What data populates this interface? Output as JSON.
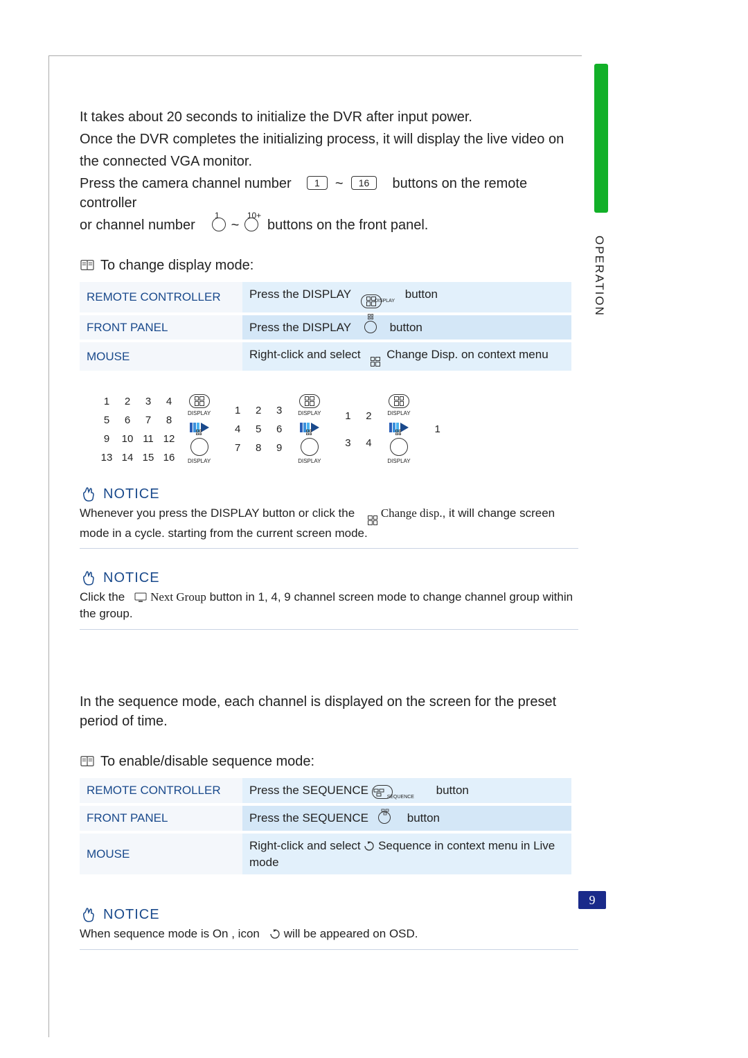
{
  "sideTab": "OPERATION",
  "pageNumber": "9",
  "intro": {
    "line1": "It takes about 20 seconds to initialize the DVR after input power.",
    "line2a": "Once the DVR completes the initializing process, it will display the live video on",
    "line2b": "the connected VGA monitor.",
    "line3a": "Press the camera channel number",
    "chanFrom": "1",
    "chanTilde": "~",
    "chanTo": "16",
    "line3b": "buttons on the remote controller",
    "line4a": "or channel number",
    "fp1": "1",
    "fpTilde": "~",
    "fp10": "10+",
    "line4b": "buttons on the front panel."
  },
  "changeDisplay": {
    "heading": "To change display mode:",
    "rows": [
      {
        "left": "REMOTE CONTROLLER",
        "rightA": "Press the DISPLAY",
        "rightB": "button"
      },
      {
        "left": "FRONT PANEL",
        "rightA": "Press the DISPLAY",
        "rightB": "button"
      },
      {
        "left": "MOUSE",
        "rightA": "Right-click and select",
        "rightB": "Change Disp. on context menu"
      }
    ],
    "iconSub": "DISPLAY"
  },
  "modes": {
    "grid16": [
      "1",
      "2",
      "3",
      "4",
      "5",
      "6",
      "7",
      "8",
      "9",
      "10",
      "11",
      "12",
      "13",
      "14",
      "15",
      "16"
    ],
    "grid9": [
      "1",
      "2",
      "3",
      "4",
      "5",
      "6",
      "7",
      "8",
      "9"
    ],
    "grid4": [
      "1",
      "2",
      "3",
      "4"
    ],
    "grid1": [
      "1"
    ],
    "sub": "DISPLAY"
  },
  "notice1": {
    "title": "NOTICE",
    "a": "Whenever you press the  DISPLAY button or click the",
    "ital": "Change disp.",
    "b": ", it will change screen",
    "c": "mode in a cycle. starting from the current screen mode."
  },
  "notice2": {
    "title": "NOTICE",
    "a": "Click the",
    "ital": "Next Group",
    "b": "button in 1, 4, 9 channel screen mode to change channel group within",
    "c": "the group."
  },
  "sequence": {
    "intro1": "In the sequence mode, each channel is displayed on the screen for the preset",
    "intro2": "period of time.",
    "heading": "To enable/disable sequence mode:",
    "rows": [
      {
        "left": "REMOTE CONTROLLER",
        "rightA": "Press the SEQUENCE",
        "rightB": "button"
      },
      {
        "left": "FRONT PANEL",
        "rightA": "Press the SEQUENCE",
        "rightB": "button"
      },
      {
        "left": "MOUSE",
        "rightA": "Right-click and select",
        "rightB": "Sequence in context menu in Live mode"
      }
    ],
    "iconSub": "SEQUENCE"
  },
  "notice3": {
    "title": "NOTICE",
    "a": "When sequence mode is  On , icon",
    "b": "will be appeared on OSD."
  }
}
